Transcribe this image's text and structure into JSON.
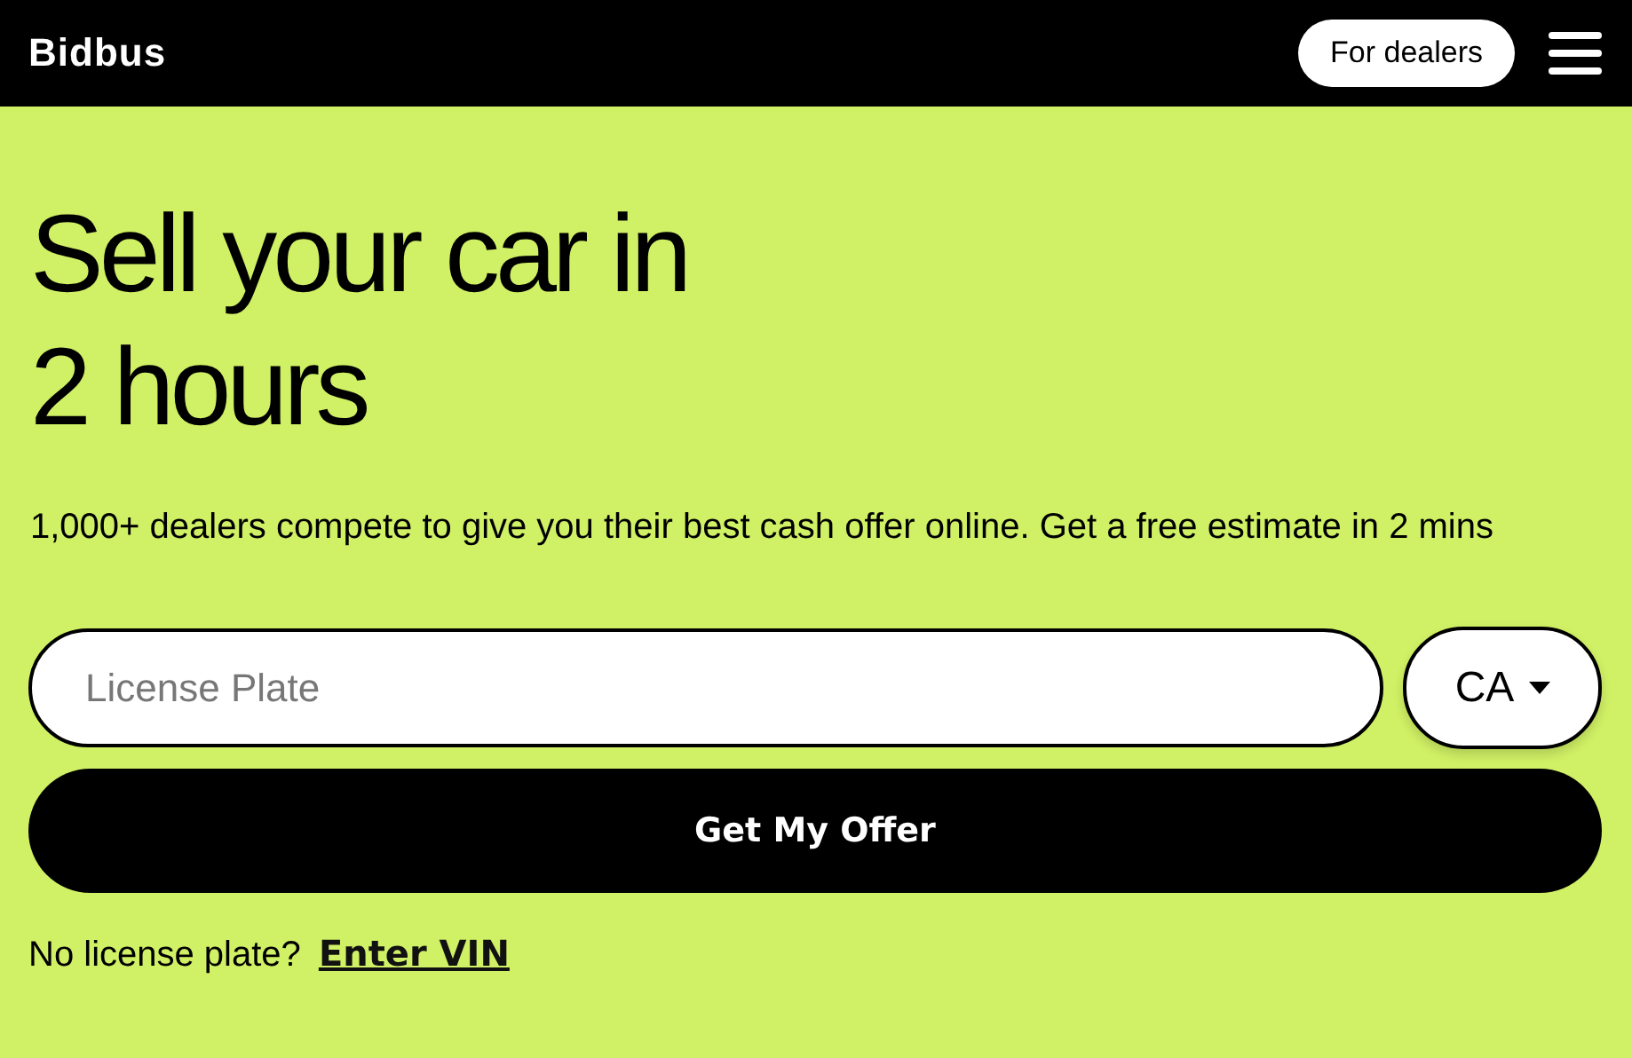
{
  "header": {
    "logo": "Bidbus",
    "dealers_button": "For dealers"
  },
  "hero": {
    "title_lines": [
      "Sell your car in",
      "2 hours"
    ],
    "subtitle": "1,000+ dealers compete to give you their best cash offer online. Get a free estimate in 2 mins",
    "plate_field": {
      "placeholder": "License Plate"
    },
    "region_select": {
      "value": "CA"
    },
    "submit_button": "Get My Offer",
    "vin_prompt": "No license plate?",
    "vin_link": "Enter VIN"
  }
}
